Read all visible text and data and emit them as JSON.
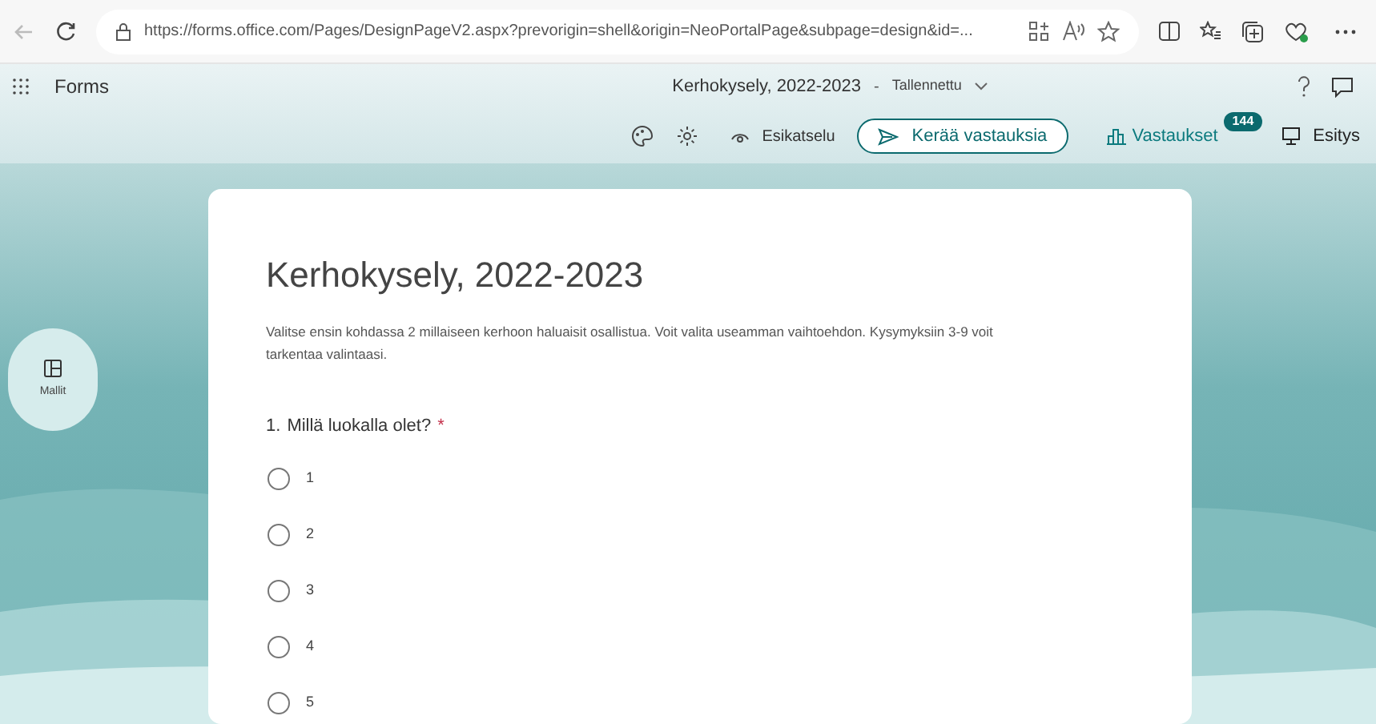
{
  "browser": {
    "url": "https://forms.office.com/Pages/DesignPageV2.aspx?prevorigin=shell&origin=NeoPortalPage&subpage=design&id=..."
  },
  "app_header": {
    "app_name": "Forms",
    "form_title": "Kerhokysely, 2022-2023",
    "separator": "-",
    "save_status": "Tallennettu"
  },
  "toolbar": {
    "preview": "Esikatselu",
    "collect": "Kerää vastauksia",
    "responses": "Vastaukset",
    "responses_count": "144",
    "present": "Esitys"
  },
  "side_button": {
    "label": "Mallit"
  },
  "form": {
    "title": "Kerhokysely, 2022-2023",
    "description": "Valitse ensin kohdassa 2 millaiseen kerhoon haluaisit osallistua. Voit valita useamman vaihtoehdon. Kysymyksiin 3-9 voit tarkentaa valintaasi.",
    "questions": [
      {
        "number": "1.",
        "text": "Millä luokalla olet?",
        "required_mark": "*",
        "options": [
          {
            "label": "1",
            "selected": false
          },
          {
            "label": "2",
            "selected": false
          },
          {
            "label": "3",
            "selected": false
          },
          {
            "label": "4",
            "selected": false
          },
          {
            "label": "5",
            "selected": false
          }
        ]
      }
    ]
  }
}
